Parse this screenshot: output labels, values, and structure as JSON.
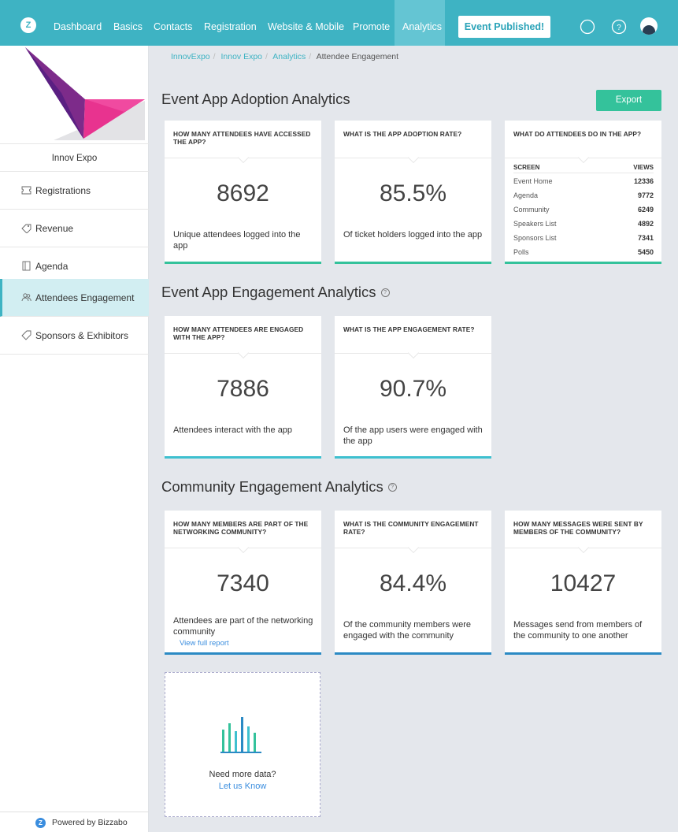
{
  "nav": {
    "items": [
      "Dashboard",
      "Basics",
      "Contacts",
      "Registration",
      "Website & Mobile",
      "Promote",
      "Analytics"
    ],
    "publish_label": "Event Published!"
  },
  "sidebar": {
    "event_name": "Innov Expo",
    "items": [
      {
        "label": "Registrations",
        "icon": "ticket-icon"
      },
      {
        "label": "Revenue",
        "icon": "money-icon"
      },
      {
        "label": "Agenda",
        "icon": "book-icon"
      },
      {
        "label": "Attendees Engagement",
        "icon": "people-icon"
      },
      {
        "label": "Sponsors & Exhibitors",
        "icon": "tag-icon"
      }
    ],
    "powered_by": "Powered by Bizzabo",
    "powered_logo": "Z"
  },
  "breadcrumb": [
    "InnovExpo",
    "Innov Expo",
    "Analytics",
    "Attendee Engagement"
  ],
  "sections": {
    "adoption": {
      "title": "Event App Adoption Analytics",
      "export_label": "Export",
      "card1": {
        "question": "How many attendees have accessed the app?",
        "value": "8692",
        "desc": "Unique attendees logged into the app"
      },
      "card2": {
        "question": "What is the app adoption rate?",
        "value": "85.5%",
        "desc": "Of ticket holders logged into the app"
      },
      "card3": {
        "question": "What do attendees do in the app?",
        "col_screen": "SCREEN",
        "col_views": "VIEWS",
        "rows": [
          {
            "screen": "Event Home",
            "views": "12336"
          },
          {
            "screen": "Agenda",
            "views": "9772"
          },
          {
            "screen": "Community",
            "views": "6249"
          },
          {
            "screen": "Speakers List",
            "views": "4892"
          },
          {
            "screen": "Sponsors List",
            "views": "7341"
          },
          {
            "screen": "Polls",
            "views": "5450"
          }
        ]
      }
    },
    "engagement": {
      "title": "Event App Engagement Analytics",
      "card1": {
        "question": "How many attendees are engaged with the app?",
        "value": "7886",
        "desc": "Attendees interact with the app"
      },
      "card2": {
        "question": "What is the app engagement rate?",
        "value": "90.7%",
        "desc": "Of the app users were engaged with the app"
      }
    },
    "community": {
      "title": "Community Engagement Analytics",
      "card1": {
        "question": "How many members are part of the networking community?",
        "value": "7340",
        "desc": "Attendees are part of the networking community",
        "link": "View full report"
      },
      "card2": {
        "question": "What is the community engagement rate?",
        "value": "84.4%",
        "desc": "Of the community members were engaged with the community"
      },
      "card3": {
        "question": "How many messages were sent by members of the community?",
        "value": "10427",
        "desc": "Messages send from members of the community to one another"
      }
    }
  },
  "more_data": {
    "text": "Need more data?",
    "link": "Let us Know"
  },
  "colors": {
    "nav": "#3eb3c3",
    "adoption_bar": "#34c29b",
    "engagement_bar": "#3ec0cf",
    "community_bar": "#2b8ac4",
    "export": "#34c29b"
  }
}
